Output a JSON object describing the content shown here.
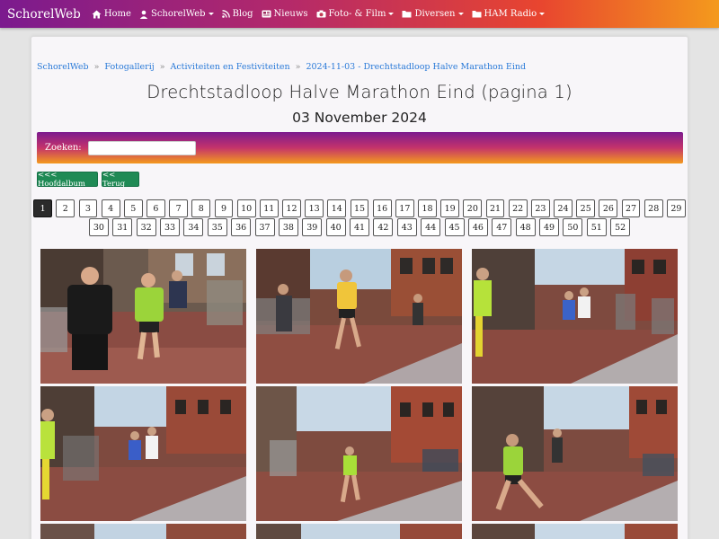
{
  "nav": {
    "brand": "SchorelWeb",
    "items": [
      {
        "label": "Home",
        "icon": "home-icon",
        "dropdown": false
      },
      {
        "label": "SchorelWeb",
        "icon": "user-icon",
        "dropdown": true
      },
      {
        "label": "Blog",
        "icon": "rss-icon",
        "dropdown": false
      },
      {
        "label": "Nieuws",
        "icon": "newspaper-icon",
        "dropdown": false
      },
      {
        "label": "Foto- & Film",
        "icon": "camera-icon",
        "dropdown": true
      },
      {
        "label": "Diversen",
        "icon": "folder-icon",
        "dropdown": true
      },
      {
        "label": "HAM Radio",
        "icon": "folder-icon",
        "dropdown": true
      }
    ]
  },
  "breadcrumb": [
    "SchorelWeb",
    "Fotogallerij",
    "Activiteiten en Festiviteiten",
    "2024-11-03 - Drechtstadloop Halve Marathon Eind"
  ],
  "page": {
    "title": "Drechtstadloop Halve Marathon Eind (pagina 1)",
    "date": "03 November 2024"
  },
  "search": {
    "label": "Zoeken:",
    "value": ""
  },
  "buttons": {
    "main_album": "<<< Hoofdalbum",
    "back": "<< Terug"
  },
  "pagination": {
    "current": 1,
    "row1": [
      "1",
      "2",
      "3",
      "4",
      "5",
      "6",
      "7",
      "8",
      "9",
      "10",
      "11",
      "12",
      "13",
      "14",
      "15",
      "16",
      "17",
      "18",
      "19",
      "20",
      "21",
      "22",
      "23",
      "24",
      "25",
      "26",
      "27",
      "28",
      "29"
    ],
    "row2": [
      "30",
      "31",
      "32",
      "33",
      "34",
      "35",
      "36",
      "37",
      "38",
      "39",
      "40",
      "41",
      "42",
      "43",
      "44",
      "45",
      "46",
      "47",
      "48",
      "49",
      "50",
      "51",
      "52"
    ]
  },
  "colors": {
    "accent_gradient": [
      "#7b1a8e",
      "#b4296a",
      "#e8452f",
      "#f49a1d"
    ],
    "link": "#2a7ad8",
    "button_green": "#1f8a55"
  }
}
